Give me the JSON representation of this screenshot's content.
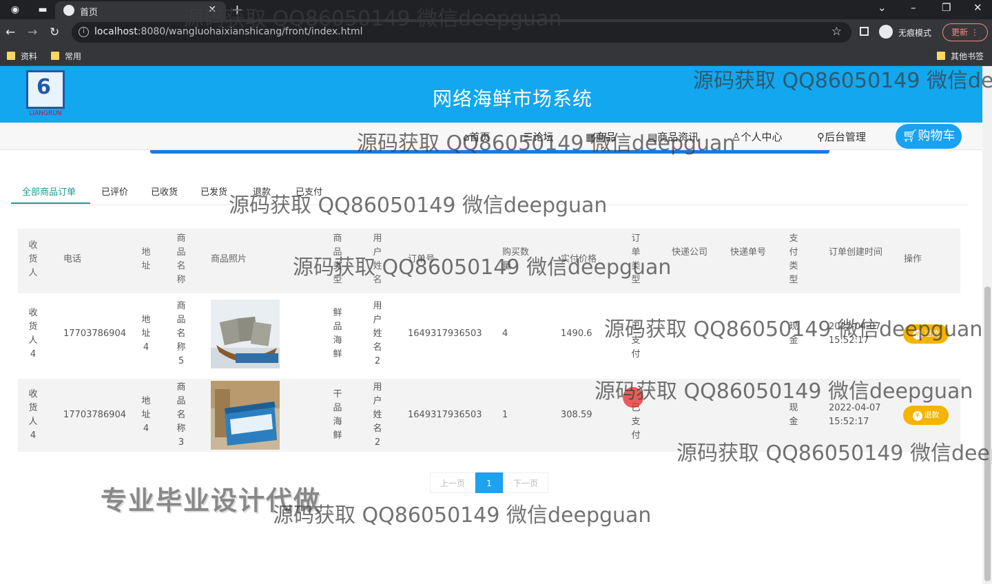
{
  "browser": {
    "tab_title": "首页",
    "url_host": "localhost",
    "url_rest": ":8080/wangluohaixianshicang/front/index.html",
    "incognito_label": "无痕模式",
    "update_label": "更新",
    "bookmarks": [
      "资料",
      "常用"
    ],
    "other_bookmarks": "其他书签"
  },
  "site": {
    "title": "网络海鲜市场系统",
    "logo_text": "LIANGRUN"
  },
  "nav": {
    "items": [
      "首页",
      "论坛",
      "商品",
      "商品资讯",
      "个人中心",
      "后台管理"
    ],
    "cart_label": "购物车"
  },
  "order_tabs": [
    "全部商品订单",
    "已评价",
    "已收货",
    "已发货",
    "退款",
    "已支付"
  ],
  "table": {
    "headers": [
      "收货人",
      "电话",
      "地址",
      "商品名称",
      "商品照片",
      "商品类型",
      "用户姓名",
      "订单号",
      "购买数量",
      "实付价格",
      "订单类型",
      "快递公司",
      "快递单号",
      "支付类型",
      "订单创建时间",
      "操作"
    ],
    "rows": [
      {
        "receiver": "收货人4",
        "phone": "17703786904",
        "address": "地址4",
        "product_name": "商品名称5",
        "product_type": "鲜品海鲜",
        "user_name": "用户姓名2",
        "order_no": "1649317936503",
        "quantity": "4",
        "price": "1490.6",
        "order_type": "已支付",
        "pay_type": "现金",
        "date": "2022-04-07",
        "time": "15:52:17",
        "action": "退款"
      },
      {
        "receiver": "收货人4",
        "phone": "17703786904",
        "address": "地址4",
        "product_name": "商品名称3",
        "product_type": "干品海鲜",
        "user_name": "用户姓名2",
        "order_no": "1649317936503",
        "quantity": "1",
        "price": "308.59",
        "order_type": "已支付",
        "pay_type": "现金",
        "date": "2022-04-07",
        "time": "15:52:17",
        "action": "退款"
      }
    ]
  },
  "pager": {
    "prev": "上一页",
    "current": "1",
    "next": "下一页"
  },
  "overlays": {
    "promo": "专业毕业设计代做",
    "watermark": "源码获取 QQ86050149 微信deepguan"
  }
}
